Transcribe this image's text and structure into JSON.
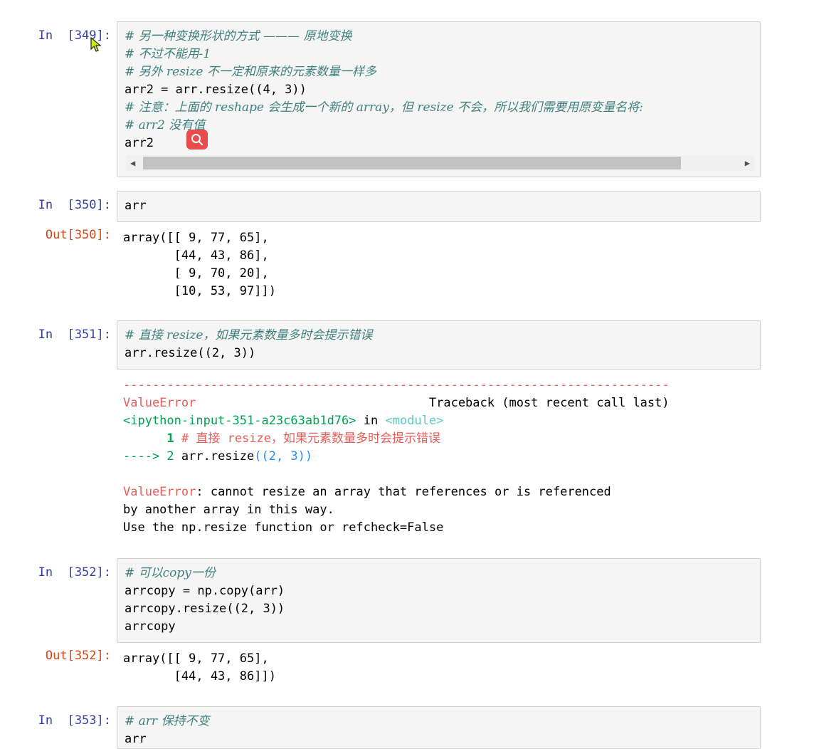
{
  "cells": {
    "c349": {
      "prompt": "In  [349]:",
      "lines": [
        "# 另一种变换形状的方式 ——— 原地变换",
        "# 不过不能用-1",
        "# 另外 resize 不一定和原来的元素数量一样多",
        "arr2 = arr.resize((4, 3))",
        "# 注意：上面的 reshape 会生成一个新的 array，但 resize 不会，所以我们需要用原变量名将:",
        "# arr2 没有值",
        "arr2"
      ]
    },
    "c350": {
      "prompt": "In  [350]:",
      "lines": [
        "arr"
      ],
      "out_prompt": "Out[350]:",
      "output": [
        "array([[ 9, 77, 65],",
        "       [44, 43, 86],",
        "       [ 9, 70, 20],",
        "       [10, 53, 97]])"
      ]
    },
    "c351": {
      "prompt": "In  [351]:",
      "lines": [
        "# 直接 resize，如果元素数量多时会提示错误",
        "arr.resize((2, 3))"
      ],
      "traceback": {
        "dashes": "---------------------------------------------------------------------------",
        "error_name": "ValueError",
        "traceback_header": "                                Traceback (most recent call last)",
        "input_ref": "<ipython-input-351-a23c63ab1d76>",
        "in_word": " in ",
        "module": "<module>",
        "line1_num": "      1",
        "line1_text": " # 直接 resize，如果元素数量多时会提示错误",
        "line2_arrow": "----> 2",
        "line2_code": " arr.resize",
        "line2_args": "((2, 3))",
        "msg_name": "ValueError",
        "msg_line1": ": cannot resize an array that references or is referenced",
        "msg_line2": "by another array in this way.",
        "msg_line3": "Use the np.resize function or refcheck=False"
      }
    },
    "c352": {
      "prompt": "In  [352]:",
      "lines": [
        "# 可以copy一份",
        "arrcopy = np.copy(arr)",
        "arrcopy.resize((2, 3))",
        "arrcopy"
      ],
      "out_prompt": "Out[352]:",
      "output": [
        "array([[ 9, 77, 65],",
        "       [44, 43, 86]])"
      ]
    },
    "c353": {
      "prompt": "In  [353]:",
      "lines": [
        "# arr 保持不变",
        "arr"
      ]
    }
  },
  "colors": {
    "in_prompt": "#303f9f",
    "out_prompt": "#d84315",
    "comment": "#408080",
    "error": "#e75c58",
    "search_badge": "#e84c4c"
  },
  "icons": [
    "search-icon",
    "mouse-cursor-icon",
    "scroll-left-arrow-icon",
    "scroll-right-arrow-icon"
  ]
}
